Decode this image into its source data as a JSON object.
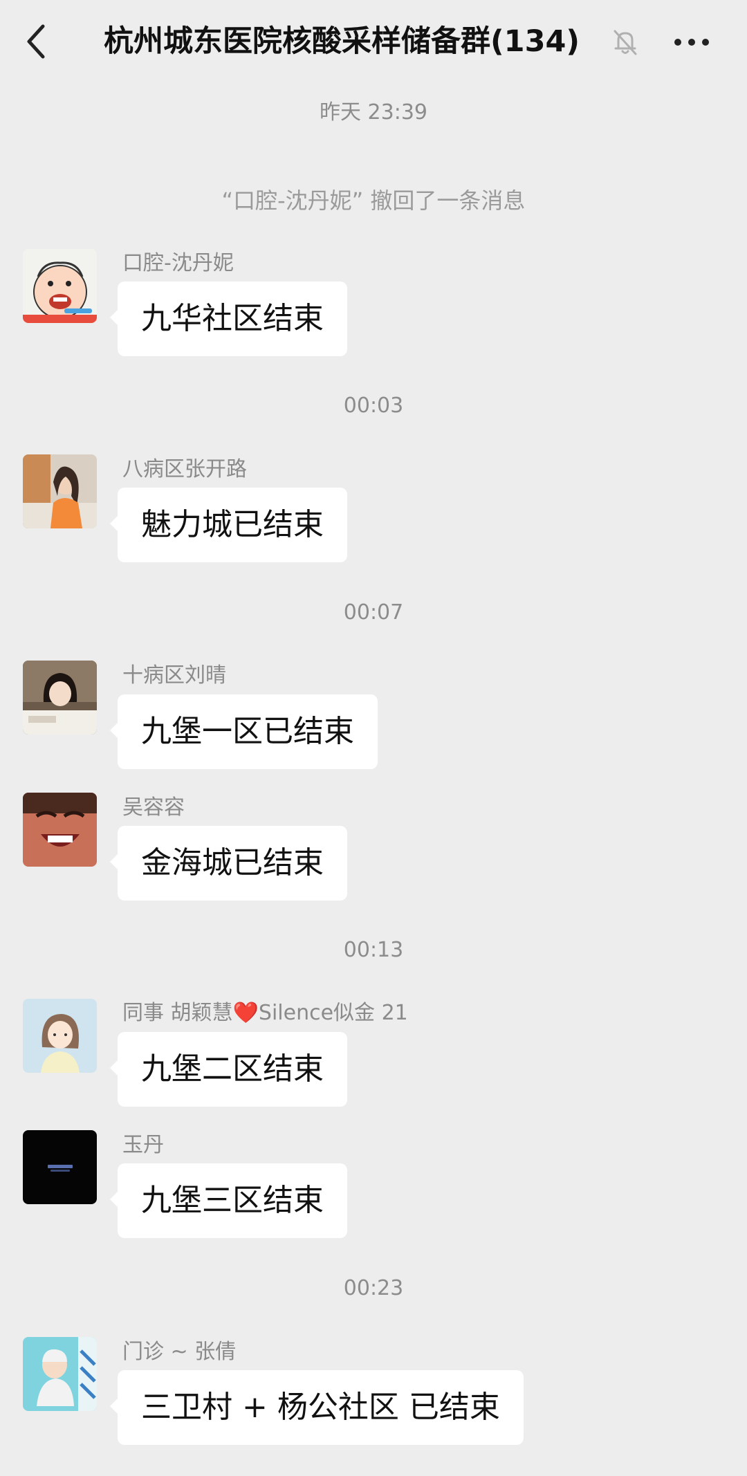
{
  "header": {
    "title": "杭州城东医院核酸采样储备群(134)",
    "back_icon": "chevron-left-icon",
    "mute_icon": "bell-off-icon",
    "more_icon": "more-dots-icon"
  },
  "chat": {
    "time_1": "昨天 23:39",
    "recall_notice": "“口腔-沈丹妮” 撤回了一条消息",
    "time_2": "00:03",
    "time_3": "00:07",
    "time_4": "00:13",
    "time_5": "00:23",
    "messages": [
      {
        "sender": "口腔-沈丹妮",
        "text": "九华社区结束"
      },
      {
        "sender": "八病区张开路",
        "text": "魅力城已结束"
      },
      {
        "sender": "十病区刘晴",
        "text": "九堡一区已结束"
      },
      {
        "sender": "吴容容",
        "text": "金海城已结束"
      },
      {
        "sender_prefix": "同事 胡颖慧",
        "sender_heart": "❤️",
        "sender_suffix": "Silence似金 21",
        "text": "九堡二区结束"
      },
      {
        "sender": "玉丹",
        "text": "九堡三区结束"
      },
      {
        "sender": "门诊 ~ 张倩",
        "text": "三卫村 + 杨公社区 已结束"
      }
    ]
  },
  "colors": {
    "background": "#ededed",
    "bubble": "#ffffff",
    "meta_text": "#8c8c8c"
  }
}
